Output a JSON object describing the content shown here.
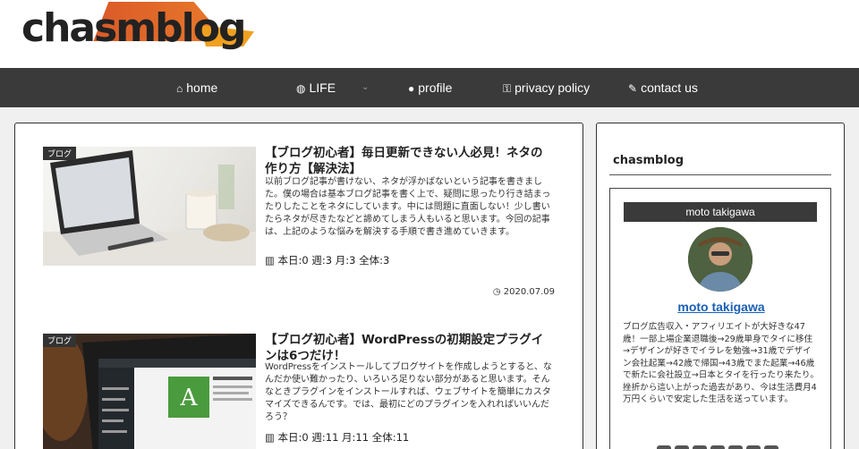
{
  "site": {
    "logo_text": "chasmblog"
  },
  "nav": {
    "items": [
      {
        "icon": "home-icon",
        "glyph": "⌂",
        "label": "home"
      },
      {
        "icon": "globe-icon",
        "glyph": "◍",
        "label": "LIFE"
      },
      {
        "icon": "person-icon",
        "glyph": "●",
        "label": "profile"
      },
      {
        "icon": "key-icon",
        "glyph": "⚿",
        "label": "privacy policy"
      },
      {
        "icon": "plug-icon",
        "glyph": "✎",
        "label": "contact us"
      }
    ],
    "caret": "⌄"
  },
  "articles": [
    {
      "category": "ブログ",
      "title": "【ブログ初心者】毎日更新できない人必見！ネタの作り方【解決法】",
      "excerpt": "以前ブログ記事が書けない、ネタが浮かばないという記事を書きました。僕の場合は基本ブログ記事を書く上で、疑問に思ったり行き詰まったりしたことをネタにしています。中には問題に直面しない！少し書いたらネタが尽きたなどと諦めてしまう人もいると思います。今回の記事は、上記のような悩みを解決する手順で書き進めていきます。",
      "stats": "本日:0  週:3  月:3  全体:3",
      "date": "2020.07.09"
    },
    {
      "category": "ブログ",
      "title": "【ブログ初心者】WordPressの初期設定プラグインは6つだけ！",
      "excerpt": "WordPressをインストールしてブログサイトを作成しようとすると、なんだか使い難かったり、いろいろ足りない部分があると思います。そんなときプラグインをインストールすれば、ウェブサイトを簡単にカスタマイズできるんです。では、最初にどのプラグインを入れればいいんだろう？",
      "stats": "本日:0  週:11  月:11  全体:11",
      "date": ""
    }
  ],
  "sidebar": {
    "title": "chasmblog",
    "profile": {
      "heading": "moto takigawa",
      "name": "moto takigawa",
      "description": "ブログ広告収入・アフィリエイトが大好きな47歳！一部上場企業退職後→29歳単身でタイに移住→デザインが好きでイラレを勉強→31歳でデザイン会社起業→42歳で帰国→43歳でまた起業→46歳で新たに会社設立→日本とタイを行ったり来たり。挫折から這い上がった過去があり、今は生活費月4万円くらいで安定した生活を送っています。",
      "socials": [
        "⌂",
        "✦",
        "f",
        "B!",
        "◎",
        "▢",
        "☰"
      ]
    }
  },
  "colors": {
    "nav_bg": "#3a3a3a",
    "link": "#1a5fb4",
    "logo_accent": "#d85528"
  }
}
